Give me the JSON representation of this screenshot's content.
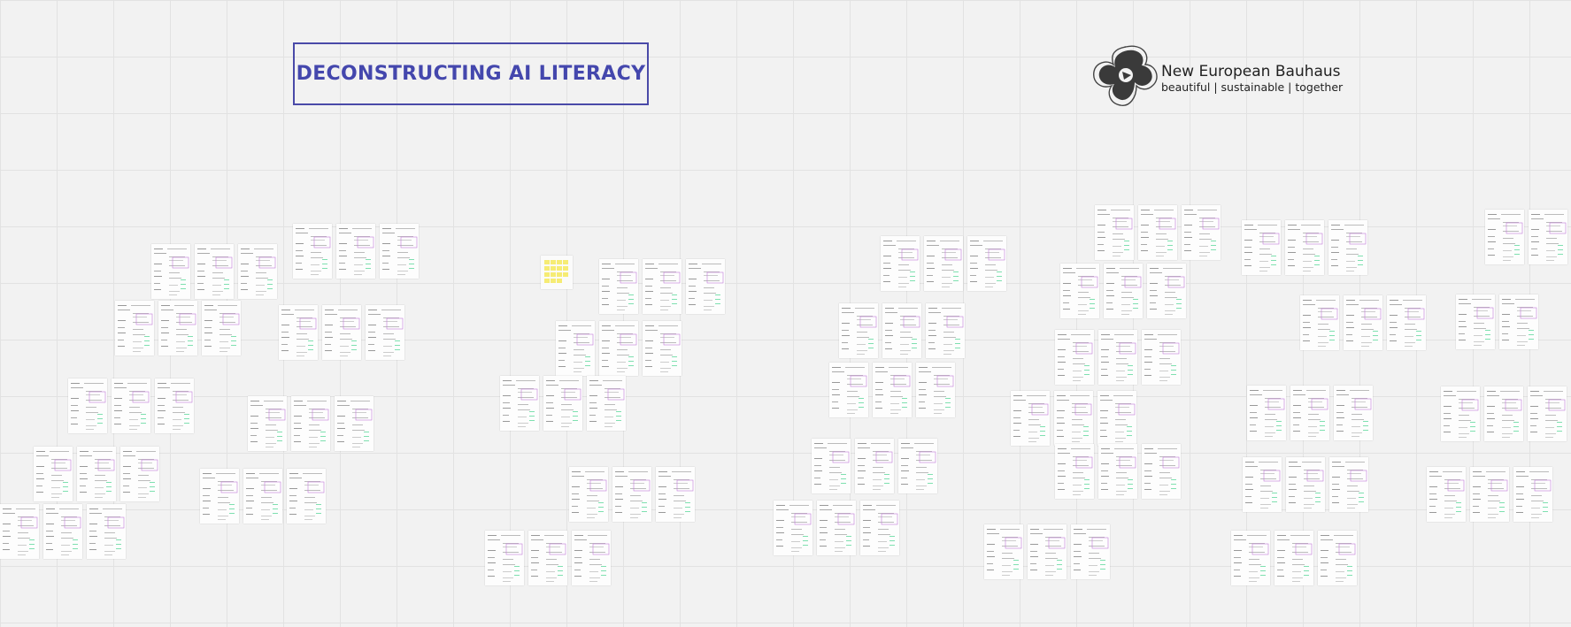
{
  "board": {
    "title": "DECONSTRUCTING AI LITERACY",
    "background_color": "#f2f2f2",
    "grid_color": "#e2e2e2",
    "title_color": "#4447ad"
  },
  "logo": {
    "name": "New European Bauhaus",
    "tagline": "beautiful | sustainable | together",
    "icon": "new-european-bauhaus-logo"
  },
  "cards": {
    "accent_colors": [
      "#c27ad8",
      "#7fe0b0"
    ],
    "count": 156
  }
}
